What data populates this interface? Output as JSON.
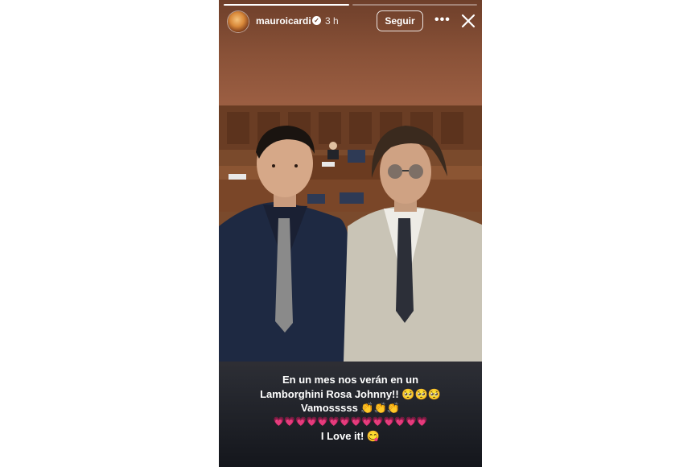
{
  "story": {
    "progress": [
      1.0,
      0.0
    ],
    "user": {
      "username": "mauroicardi",
      "verified_icon": "verified-check-icon",
      "time": "3 h"
    },
    "follow_label": "Seguir",
    "more_icon": "more-dots-icon",
    "more_glyph": "•••",
    "close_icon": "close-icon"
  },
  "caption": {
    "line1": "En un mes nos verán en un",
    "line2": "Lamborghini Rosa Johnny!! 🥺🥺🥺",
    "line3": "Vamosssss 👏👏👏",
    "line4": "💗💗💗💗💗💗💗💗💗💗💗💗💗💗",
    "line5": "I Love it! 😋"
  },
  "colors": {
    "story_top": "#8a5238",
    "story_bottom": "#14161c",
    "accent_text": "#ffffff"
  }
}
